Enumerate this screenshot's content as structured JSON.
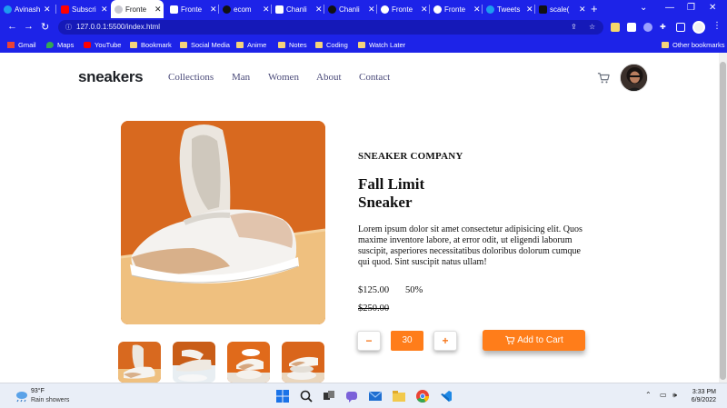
{
  "browser": {
    "tabs": [
      {
        "label": "Avinash",
        "icon": "twitter-icon",
        "color": "#1d9bf0"
      },
      {
        "label": "Subscri",
        "icon": "youtube-icon",
        "color": "#ff0000"
      },
      {
        "label": "Fronte",
        "icon": "globe-icon",
        "color": "#ffffff",
        "active": true
      },
      {
        "label": "Fronte",
        "icon": "page-icon",
        "color": "#ffffff"
      },
      {
        "label": "ecom",
        "icon": "github-icon",
        "color": "#111111"
      },
      {
        "label": "Chanli",
        "icon": "page-icon",
        "color": "#ffffff"
      },
      {
        "label": "Chanli",
        "icon": "github-icon",
        "color": "#111111"
      },
      {
        "label": "Fronte",
        "icon": "globe-icon",
        "color": "#ffffff"
      },
      {
        "label": "Fronte",
        "icon": "frontend-mentor-icon",
        "color": "#ffffff"
      },
      {
        "label": "Tweets",
        "icon": "twitter-icon",
        "color": "#1d9bf0"
      },
      {
        "label": "scale(",
        "icon": "medium-icon",
        "color": "#111111"
      }
    ],
    "url": "127.0.0.1:5500/index.html",
    "bookmarks": [
      {
        "label": "Gmail",
        "icon": "gmail-icon"
      },
      {
        "label": "Maps",
        "icon": "maps-icon"
      },
      {
        "label": "YouTube",
        "icon": "youtube-icon"
      },
      {
        "label": "Bookmark",
        "icon": "folder-icon"
      },
      {
        "label": "Social Media",
        "icon": "folder-icon"
      },
      {
        "label": "Anime",
        "icon": "folder-icon"
      },
      {
        "label": "Notes",
        "icon": "folder-icon"
      },
      {
        "label": "Coding",
        "icon": "folder-icon"
      },
      {
        "label": "Watch Later",
        "icon": "folder-icon"
      }
    ],
    "other_bookmarks": "Other bookmarks",
    "accent": "#1d23e8"
  },
  "site": {
    "brand": "sneakers",
    "nav": [
      "Collections",
      "Man",
      "Women",
      "About",
      "Contact"
    ]
  },
  "product": {
    "company": "SNEAKER COMPANY",
    "title_line1": "Fall Limit",
    "title_line2": "Sneaker",
    "description": "Lorem ipsum dolor sit amet consectetur adipisicing elit. Quos maxime inventore labore, at error odit, ut eligendi laborum suscipit, asperiores necessitatibus doloribus dolorum cumque qui quod. Sint suscipit natus ullam!",
    "price": "$125.00",
    "discount": "50%",
    "original_price": "$250.00",
    "quantity": "30",
    "minus_label": "−",
    "plus_label": "+",
    "add_to_cart": "Add to Cart",
    "accent": "#ff7d1a"
  },
  "taskbar": {
    "weather_temp": "93°F",
    "weather_desc": "Rain showers",
    "time": "3:33 PM",
    "date": "6/9/2022"
  }
}
